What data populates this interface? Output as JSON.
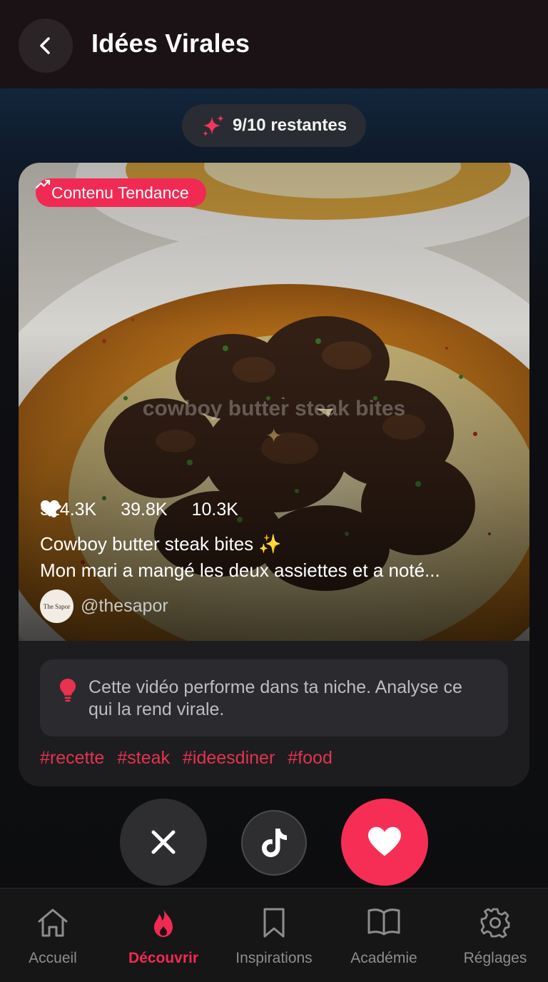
{
  "header": {
    "title": "Idées Virales"
  },
  "quota": {
    "label": "9/10 restantes"
  },
  "card": {
    "badge": "Contenu Tendance",
    "overlay_text": "cowboy butter steak bites",
    "stats": {
      "views": "514.3K",
      "likes": "39.8K",
      "shares": "10.3K"
    },
    "caption_line1": "Cowboy butter steak bites ✨",
    "caption_line2": "Mon mari a mangé les deux assiettes et a noté...",
    "author": {
      "avatar_text": "The Sapor",
      "handle": "@thesapor"
    },
    "insight": "Cette vidéo performe dans ta niche. Analyse ce qui la rend virale.",
    "hashtags": [
      "#recette",
      "#steak",
      "#ideesdiner",
      "#food"
    ]
  },
  "nav": {
    "items": [
      {
        "label": "Accueil",
        "icon": "home-icon"
      },
      {
        "label": "Découvrir",
        "icon": "flame-icon",
        "active": true
      },
      {
        "label": "Inspirations",
        "icon": "bookmark-icon"
      },
      {
        "label": "Académie",
        "icon": "book-icon"
      },
      {
        "label": "Réglages",
        "icon": "gear-icon"
      }
    ]
  },
  "colors": {
    "accent": "#f02a52",
    "background": "#0d0d0f",
    "header": "#1a1214"
  }
}
